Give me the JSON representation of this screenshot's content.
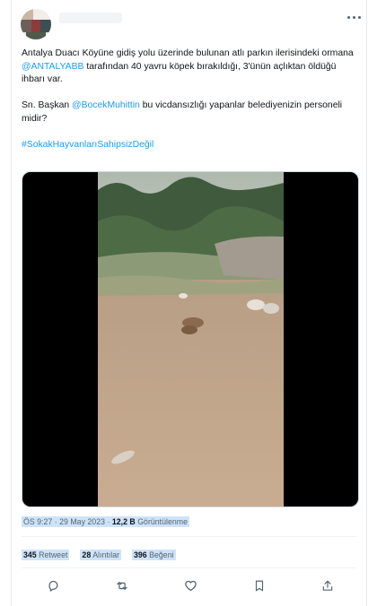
{
  "tweet": {
    "paragraph1_a": "Antalya Duacı Köyüne gidiş yolu üzerinde bulunan atlı parkın ilerisindeki ormana ",
    "mention1": "@ANTALYABB",
    "paragraph1_b": " tarafından 40 yavru köpek bırakıldığı, 3'ünün açlıktan öldüğü ihbarı var.",
    "paragraph2_a": "Sn. Başkan ",
    "mention2": "@BocekMuhittin",
    "paragraph2_b": " bu vicdansızlığı yapanlar belediyenizin personeli midir?",
    "hashtag": "#SokakHayvanlarıSahipsizDeğil"
  },
  "meta": {
    "time": "ÖS 9:27",
    "date": "29 May 2023",
    "separator": "·",
    "views_count": "12,2 B",
    "views_label": "Görüntülenme"
  },
  "stats": {
    "retweets_count": "345",
    "retweets_label": "Retweet",
    "quotes_count": "28",
    "quotes_label": "Alıntılar",
    "likes_count": "396",
    "likes_label": "Beğeni"
  },
  "icons": {
    "reply": "reply-icon",
    "retweet": "retweet-icon",
    "like": "heart-icon",
    "bookmark": "bookmark-icon",
    "share": "share-icon",
    "more": "more-icon"
  },
  "colors": {
    "link": "#1d9bf0",
    "text": "#0f1419",
    "muted": "#536471",
    "highlight": "#cfe3f8"
  }
}
